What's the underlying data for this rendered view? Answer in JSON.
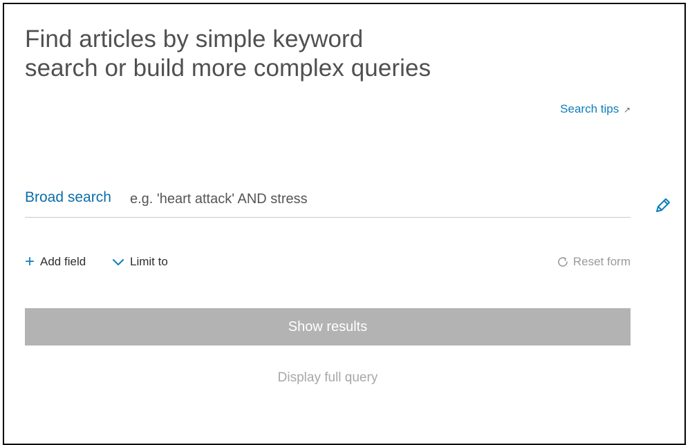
{
  "heading": {
    "line1": "Find articles by simple keyword",
    "line2": "search or build more complex queries"
  },
  "search_tips": {
    "label": "Search tips",
    "external_glyph": "↗",
    "icon": "external-link-icon"
  },
  "broad_search": {
    "label": "Broad search",
    "value": "",
    "placeholder": "e.g. 'heart attack' AND stress",
    "icon": "pencil-icon"
  },
  "actions": {
    "add_field_glyph": "+",
    "add_field_label": "Add field",
    "add_field_icon": "plus-icon",
    "limit_to_label": "Limit to",
    "limit_to_icon": "chevron-down-icon",
    "reset_label": "Reset form",
    "reset_icon": "refresh-icon"
  },
  "show_results": {
    "label": "Show results"
  },
  "display_full_query": {
    "label": "Display full query"
  },
  "colors": {
    "accent": "#0c7dbb",
    "label_blue": "#0b6ea8",
    "disabled_button": "#b3b3b3",
    "muted_text": "#a7a7a7",
    "title_text": "#505050"
  }
}
